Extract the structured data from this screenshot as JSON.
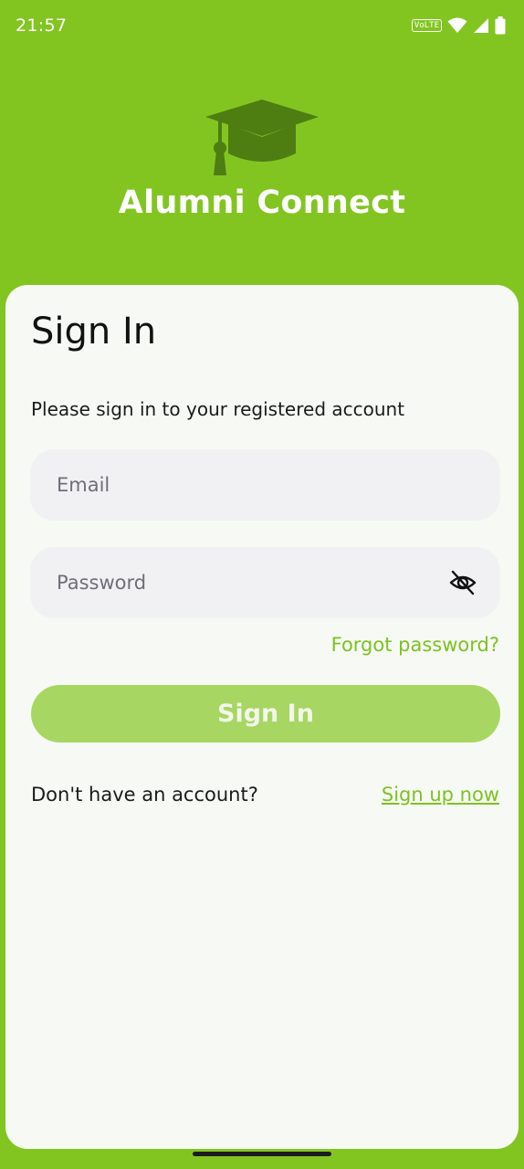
{
  "status_bar": {
    "time": "21:57",
    "volte_label": "VoLTE",
    "icons": [
      "volte-icon",
      "wifi-icon",
      "signal-icon",
      "battery-icon"
    ]
  },
  "header": {
    "logo_icon": "graduation-cap-icon",
    "app_title": "Alumni Connect"
  },
  "signin": {
    "title": "Sign In",
    "subtitle": "Please sign in to your registered account",
    "email": {
      "placeholder": "Email",
      "value": ""
    },
    "password": {
      "placeholder": "Password",
      "value": "",
      "toggle_icon": "eye-off-icon"
    },
    "forgot_password": "Forgot password?",
    "submit_label": "Sign In",
    "no_account_text": "Don't have an account?",
    "signup_link": "Sign up now"
  },
  "colors": {
    "brand_green": "#82c521",
    "logo_dark_green": "#4e7d12",
    "link_green": "#7cc221",
    "button_disabled": "#a7d662",
    "card_background": "#f7faf4",
    "input_background": "#f1f1f3"
  }
}
